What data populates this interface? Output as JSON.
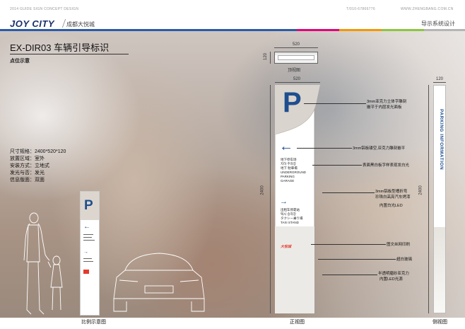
{
  "header": {
    "top_left_small": "2014 GUIDE SIGN CONCEPT DESIGN",
    "top_right_small_phone": "T/010-67866776",
    "top_right_small_web": "WWW.ZHENGBANG.COM.CN",
    "brand": "JOY CITY",
    "brand_sub": "成都大悦城",
    "system": "导示系统设计"
  },
  "colorbar": [
    "#2b5aa8",
    "#e2007a",
    "#f39800",
    "#8cc63f",
    "#b5b5b5"
  ],
  "title": "EX-DIR03  车辆引导标识",
  "subtitle": "点位示意",
  "specs": [
    "尺寸规格：2400*520*120",
    "放置区域：室外",
    "安装方式：立地式",
    "发光与否：发光",
    "信息版面：双面"
  ],
  "dimensions": {
    "top_width": "520",
    "top_depth": "120",
    "front_width": "520",
    "side_width": "120",
    "height_front": "2400",
    "height_side": "2400"
  },
  "views": {
    "top": "顶视图",
    "front": "正视图",
    "side": "侧视图",
    "scale": "比例示意图"
  },
  "sign": {
    "p_letter": "P",
    "arrow_left": "←",
    "arrow_right": "→",
    "cn_parking": "地下停车场",
    "jp_parking": "地下 駐車場",
    "ko_parking": "지하 주차장",
    "en_parking": "UNDERGROUND PARKING GARAGE",
    "cn_taxi": "出租车停靠站",
    "ko_taxi": "택시 승차장",
    "jp_taxi": "タクシー乗り場",
    "en_taxi": "TAXI STAND",
    "logo": "大悦城"
  },
  "side_text": "PARKING INFORMATION",
  "annotations": [
    "3mm亚克力立体字雕刻",
    "嵌平于内层发光面板",
    "3mm铝板镂空,亚克力雕刻嵌平",
    "表面黑白板字样表现发白光",
    "3mm铝板型槽折弯",
    "珍珠白高亮汽车烤漆",
    "内置白光LED",
    "图文丝网印刷",
    "超白玻璃",
    "半透明磨砂亚克力",
    "内置LED光源"
  ]
}
